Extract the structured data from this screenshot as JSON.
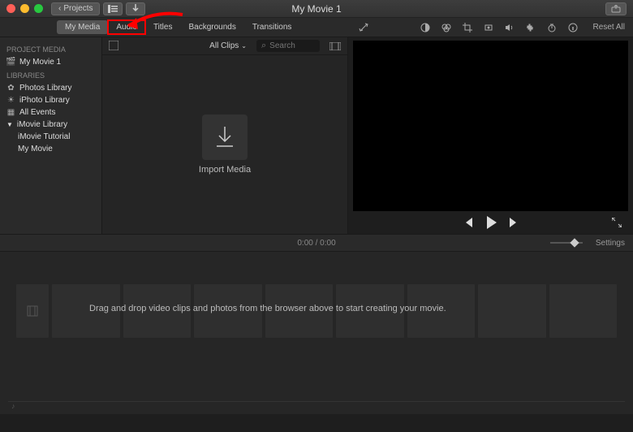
{
  "titlebar": {
    "projects_label": "Projects",
    "app_title": "My Movie 1"
  },
  "tabs": {
    "my_media": "My Media",
    "audio": "Audio",
    "titles": "Titles",
    "backgrounds": "Backgrounds",
    "transitions": "Transitions",
    "reset_all": "Reset All"
  },
  "sidebar": {
    "project_media_head": "Project Media",
    "project_name": "My Movie 1",
    "libraries_head": "Libraries",
    "photos_library": "Photos Library",
    "iphoto_library": "iPhoto Library",
    "all_events": "All Events",
    "imovie_library": "iMovie Library",
    "imovie_tutorial": "iMovie Tutorial",
    "my_movie": "My Movie"
  },
  "browser": {
    "all_clips": "All Clips",
    "search_placeholder": "Search",
    "import_label": "Import Media"
  },
  "ruler": {
    "time": "0:00 / 0:00",
    "settings": "Settings"
  },
  "timeline": {
    "message": "Drag and drop video clips and photos from the browser above to start creating your movie."
  },
  "colors": {
    "highlight": "#ff0000"
  }
}
